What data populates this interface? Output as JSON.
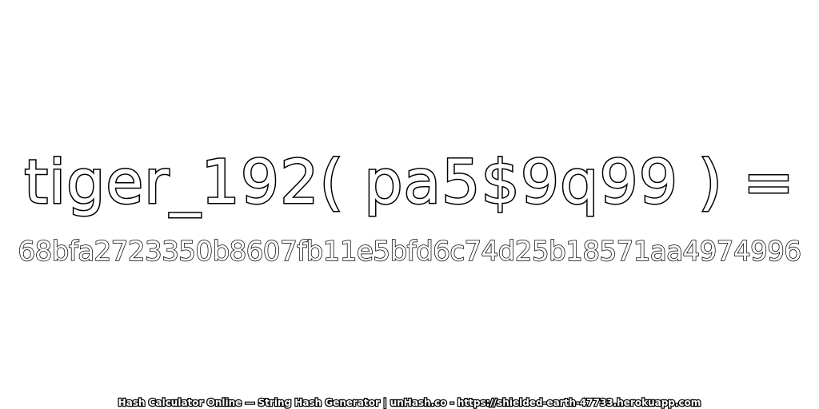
{
  "expression": "tiger_192( pa5$9q99 ) =",
  "hash_value": "68bfa2723350b8607fb11e5bfd6c74d25b18571aa4974996",
  "footer": "Hash Calculator Online — String Hash Generator | unHash.co - https://shielded-earth-47733.herokuapp.com",
  "colors": {
    "background": "#ffffff",
    "text_fill": "#ffffff",
    "text_outline": "#000000"
  }
}
